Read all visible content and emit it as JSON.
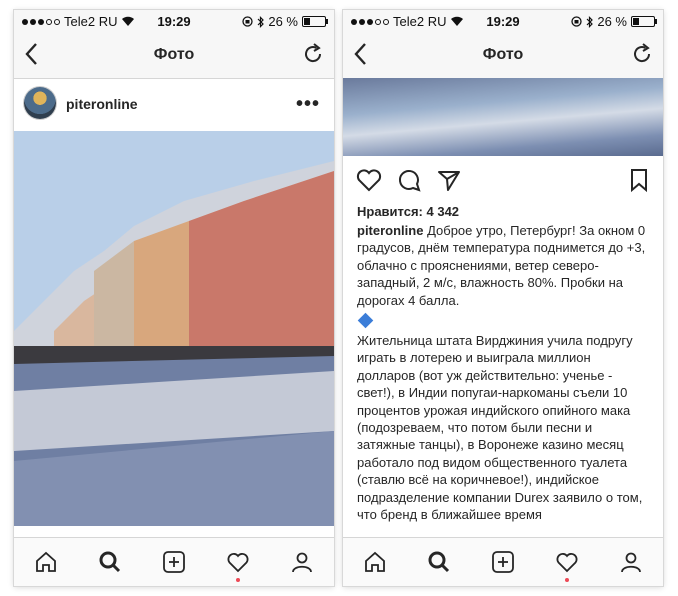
{
  "status": {
    "carrier": "Tele2 RU",
    "time": "19:29",
    "battery_text": "26 %",
    "battery_level": 0.26
  },
  "nav": {
    "title": "Фото"
  },
  "post": {
    "username": "piteronline",
    "more": "•••",
    "likes": "Нравится: 4 342",
    "caption_user": "piteronline",
    "caption_text": " Доброе утро, Петербург! За окном 0 градусов, днём температура поднимется до +3, облачно с прояснениями, ветер северо-западный, 2 м/с, влажность 80%. Пробки на дорогах 4 балла.",
    "caption_text2": "Жительница штата Вирджиния учила подругу играть в лотерею и выиграла миллион долларов (вот уж действительно: ученье - свет!), в Индии попугаи-наркоманы съели 10 процентов урожая индийского опийного мака (подозреваем, что потом были песни и затяжные танцы), в Воронеже казино месяц работало под видом общественного туалета (ставлю всё на коричневое!), индийское подразделение компании Durex заявило о том, что бренд в ближайшее время"
  },
  "icons": {
    "back": "chevron-left-icon",
    "refresh": "refresh-icon",
    "like": "heart-icon",
    "comment": "comment-icon",
    "share": "send-icon",
    "save": "bookmark-icon",
    "tabs": [
      "home-icon",
      "search-icon",
      "add-icon",
      "activity-icon",
      "profile-icon"
    ]
  },
  "colors": {
    "notification_dot": "#ed4956",
    "diamond": "#3b7dd8",
    "text": "#262626"
  }
}
